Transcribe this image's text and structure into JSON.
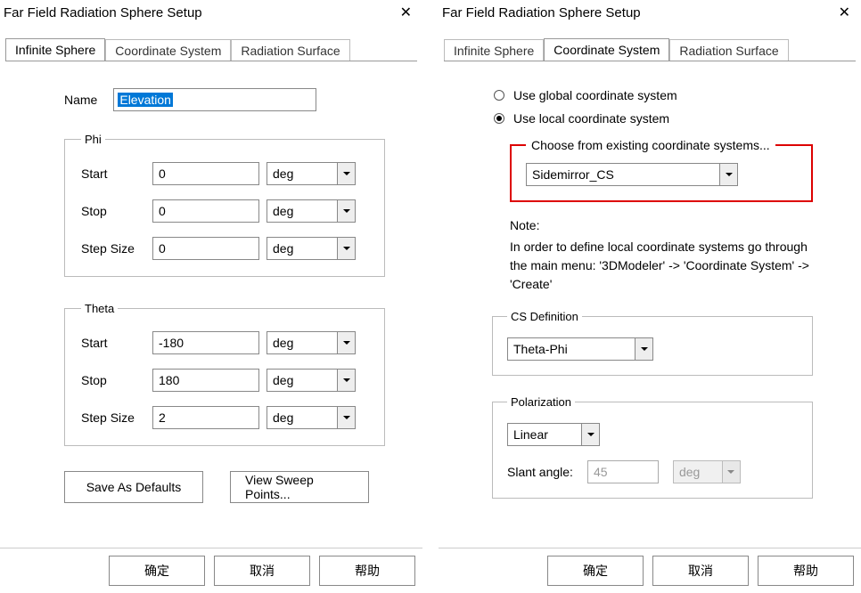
{
  "dialog1": {
    "title": "Far Field Radiation Sphere Setup",
    "tabs": [
      "Infinite Sphere",
      "Coordinate System",
      "Radiation Surface"
    ],
    "name_label": "Name",
    "name_value": "Elevation",
    "phi": {
      "legend": "Phi",
      "start_label": "Start",
      "start_value": "0",
      "stop_label": "Stop",
      "stop_value": "0",
      "step_label": "Step Size",
      "step_value": "0",
      "unit": "deg"
    },
    "theta": {
      "legend": "Theta",
      "start_label": "Start",
      "start_value": "-180",
      "stop_label": "Stop",
      "stop_value": "180",
      "step_label": "Step Size",
      "step_value": "2",
      "unit": "deg"
    },
    "save_defaults": "Save As Defaults",
    "view_sweep": "View Sweep Points...",
    "ok": "确定",
    "cancel": "取消",
    "help": "帮助"
  },
  "dialog2": {
    "title": "Far Field Radiation Sphere Setup",
    "tabs": [
      "Infinite Sphere",
      "Coordinate System",
      "Radiation Surface"
    ],
    "radio_global": "Use global coordinate system",
    "radio_local": "Use local coordinate system",
    "choose_legend": "Choose from existing coordinate systems...",
    "choose_value": "Sidemirror_CS",
    "note_title": "Note:",
    "note_body": "In order to define local coordinate systems go through the main menu: '3DModeler' -> 'Coordinate System' -> 'Create'",
    "csdef_legend": "CS Definition",
    "csdef_value": "Theta-Phi",
    "pol_legend": "Polarization",
    "pol_value": "Linear",
    "slant_label": "Slant angle:",
    "slant_value": "45",
    "slant_unit": "deg",
    "ok": "确定",
    "cancel": "取消",
    "help": "帮助"
  }
}
